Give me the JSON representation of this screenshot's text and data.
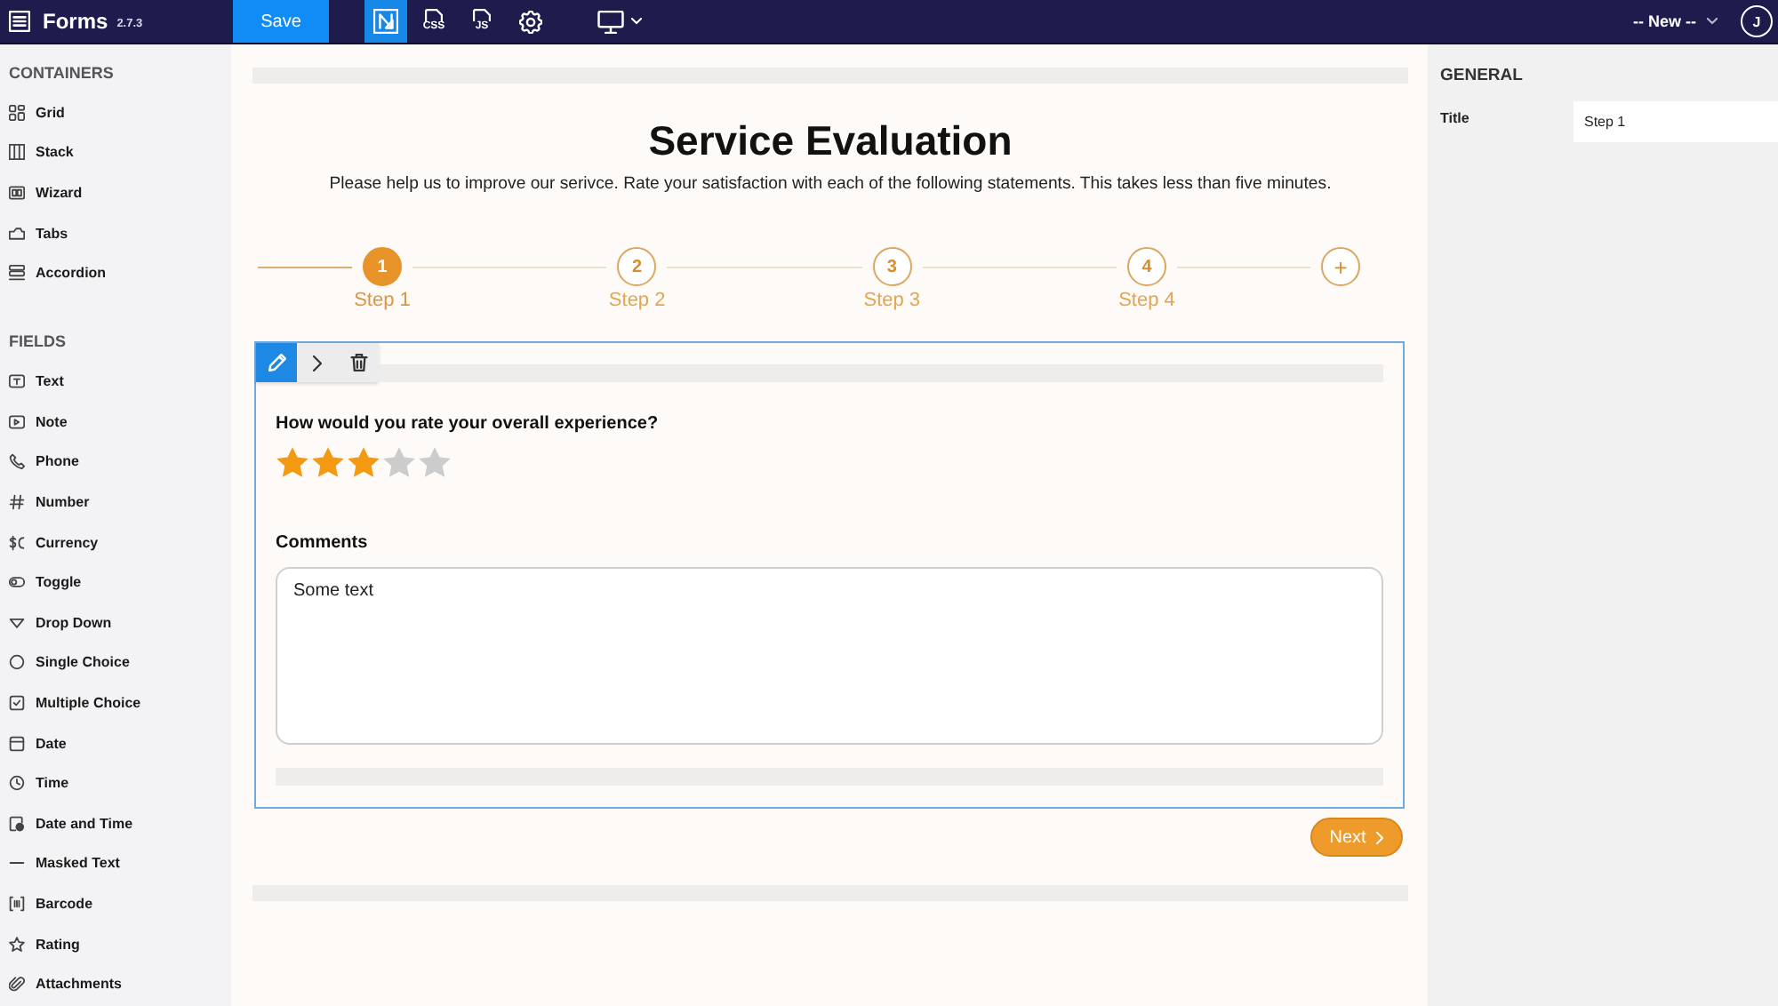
{
  "top_bar": {
    "app_name": "Forms",
    "version": "2.7.3",
    "save_button": "Save",
    "tools": [
      {
        "kind": "builder",
        "selected": true
      },
      {
        "kind": "css",
        "label": "CSS",
        "selected": false
      },
      {
        "kind": "js",
        "label": "JS",
        "selected": false
      },
      {
        "kind": "settings",
        "selected": false
      }
    ],
    "template_select": "-- New --",
    "user_initial": "J"
  },
  "palette": {
    "sections": [
      {
        "title": "CONTAINERS",
        "items": [
          {
            "label": "Grid",
            "kind": "grid"
          },
          {
            "label": "Stack",
            "kind": "stack"
          },
          {
            "label": "Wizard",
            "kind": "wizard"
          },
          {
            "label": "Tabs",
            "kind": "tabs"
          },
          {
            "label": "Accordion",
            "kind": "accordion"
          }
        ]
      },
      {
        "title": "FIELDS",
        "items": [
          {
            "label": "Text",
            "kind": "text"
          },
          {
            "label": "Note",
            "kind": "note"
          },
          {
            "label": "Phone",
            "kind": "phone"
          },
          {
            "label": "Number",
            "kind": "number"
          },
          {
            "label": "Currency",
            "kind": "currency"
          },
          {
            "label": "Toggle",
            "kind": "toggle"
          },
          {
            "label": "Drop Down",
            "kind": "dropdown"
          },
          {
            "label": "Single Choice",
            "kind": "single"
          },
          {
            "label": "Multiple Choice",
            "kind": "multiple"
          },
          {
            "label": "Date",
            "kind": "date"
          },
          {
            "label": "Time",
            "kind": "time"
          },
          {
            "label": "Date and Time",
            "kind": "datetime"
          },
          {
            "label": "Masked Text",
            "kind": "masked"
          },
          {
            "label": "Barcode",
            "kind": "barcode"
          },
          {
            "label": "Rating",
            "kind": "rating"
          },
          {
            "label": "Attachments",
            "kind": "attachments"
          }
        ]
      }
    ]
  },
  "form": {
    "title": "Service Evaluation",
    "description": "Please help us to improve our serivce. Rate your satisfaction with each of the following statements. This takes less than five minutes.",
    "steps": [
      {
        "number": "1",
        "label": "Step 1",
        "selected": true
      },
      {
        "number": "2",
        "label": "Step 2",
        "selected": false
      },
      {
        "number": "3",
        "label": "Step 3",
        "selected": false
      },
      {
        "number": "4",
        "label": "Step 4",
        "selected": false
      }
    ],
    "add_step": "+",
    "card_tools": [
      {
        "kind": "edit",
        "selected": true
      },
      {
        "kind": "expand",
        "selected": false
      },
      {
        "kind": "delete",
        "selected": false
      }
    ],
    "fields": [
      {
        "kind": "rating",
        "label": "How would you rate your overall experience?",
        "stars": 3
      },
      {
        "kind": "textarea",
        "label": "Comments",
        "value": "Some text"
      }
    ],
    "next_button": "Next"
  },
  "properties": {
    "section": "GENERAL",
    "fields": [
      {
        "label": "Title",
        "value": "Step 1"
      }
    ]
  }
}
